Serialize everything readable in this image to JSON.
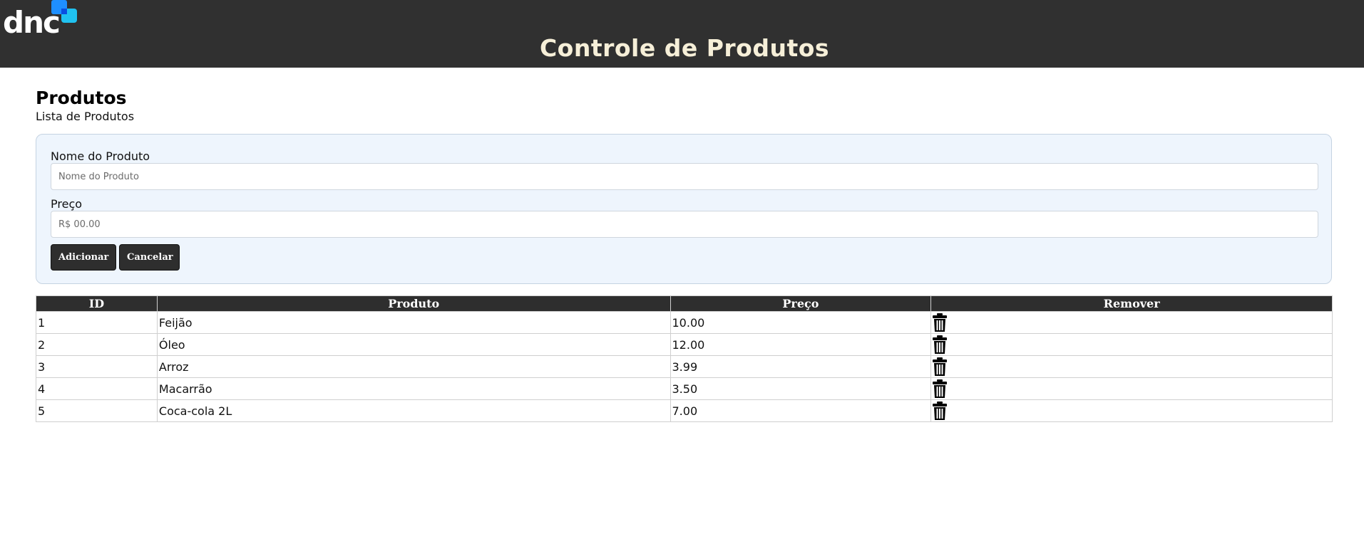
{
  "header": {
    "logo_text": "dnc",
    "title": "Controle de Produtos"
  },
  "page": {
    "title": "Produtos",
    "subtitle": "Lista de Produtos"
  },
  "form": {
    "name_label": "Nome do Produto",
    "name_placeholder": "Nome do Produto",
    "name_value": "",
    "price_label": "Preço",
    "price_placeholder": "R$ 00.00",
    "price_value": "",
    "add_button": "Adicionar",
    "cancel_button": "Cancelar"
  },
  "table": {
    "columns": [
      "ID",
      "Produto",
      "Preço",
      "Remover"
    ],
    "rows": [
      {
        "id": "1",
        "product": "Feijão",
        "price": "10.00",
        "remove_icon": "trash-icon"
      },
      {
        "id": "2",
        "product": "Óleo",
        "price": "12.00",
        "remove_icon": "trash-icon"
      },
      {
        "id": "3",
        "product": "Arroz",
        "price": "3.99",
        "remove_icon": "trash-icon"
      },
      {
        "id": "4",
        "product": "Macarrão",
        "price": "3.50",
        "remove_icon": "trash-icon"
      },
      {
        "id": "5",
        "product": "Coca-cola 2L",
        "price": "7.00",
        "remove_icon": "trash-icon"
      }
    ]
  },
  "colors": {
    "header_bg": "#303030",
    "title_color": "#f6efd8",
    "logo_blue": "#1e8fff",
    "logo_cyan": "#20c2f0",
    "form_bg": "#eef5fd",
    "button_bg": "#2e2e2e"
  }
}
